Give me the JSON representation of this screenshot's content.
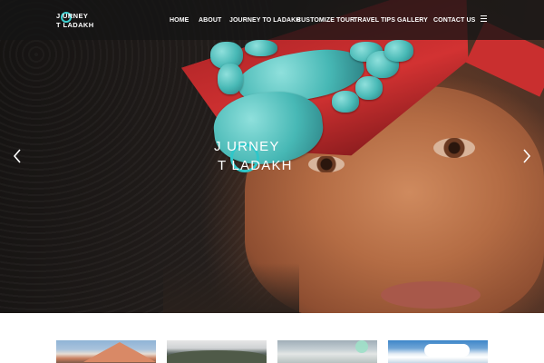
{
  "brand": {
    "logo_line1": "J  URNEY",
    "logo_line2": "T  LADAKH",
    "accent_color": "#2fc7c9"
  },
  "nav": {
    "items": [
      {
        "label": "HOME"
      },
      {
        "label": "ABOUT"
      },
      {
        "label": "JOURNEY TO LADAKH"
      },
      {
        "label": "CUSTOMIZE TOUR"
      },
      {
        "label": "TRAVEL TIPS"
      },
      {
        "label": "GALLERY"
      },
      {
        "label": "CONTACT US"
      }
    ],
    "menu_icon": "hamburger-menu-icon"
  },
  "hero": {
    "logo_line1": "J   URNEY",
    "logo_line2": "T   LADAKH",
    "prev_icon": "chevron-left-icon",
    "next_icon": "chevron-right-icon"
  },
  "thumbnails": [
    {
      "name": "mountain-thumbnail"
    },
    {
      "name": "valley-thumbnail"
    },
    {
      "name": "lake-thumbnail"
    },
    {
      "name": "sky-thumbnail"
    }
  ]
}
